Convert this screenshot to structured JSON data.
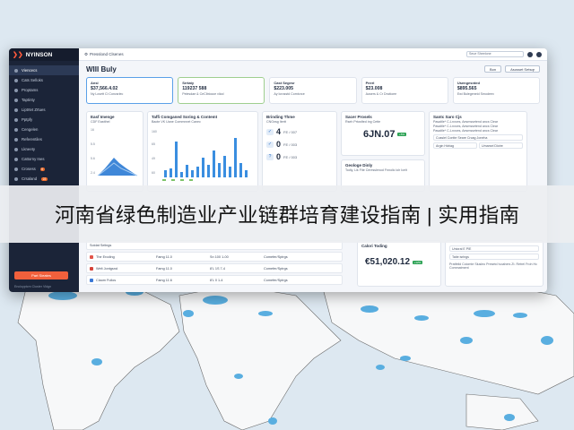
{
  "app": {
    "logo": "NYINSON",
    "workspace": "Presslond Clsenes",
    "search_placeholder": "Seue Sheelone"
  },
  "sidebar": {
    "items": [
      {
        "label": "Viencecs",
        "active": true
      },
      {
        "label": "Cats Selloks"
      },
      {
        "label": "Proptams"
      },
      {
        "label": "Taptinty"
      },
      {
        "label": "Liptrtet Zrtues"
      },
      {
        "label": "Pptpfy"
      },
      {
        "label": "Cengelen"
      },
      {
        "label": "Referentiles"
      },
      {
        "label": "Lkneety"
      },
      {
        "label": "Cattorny Ines"
      },
      {
        "label": "Crosess",
        "badge": "6"
      },
      {
        "label": "Crsaland",
        "badge": "22"
      }
    ],
    "cta": "Part Sieates",
    "footer": "Encloyptcm Cluster Vldgn"
  },
  "header": {
    "title": "WIII Buly",
    "btn1": "Bon",
    "btn2": "Asosset Setsqr"
  },
  "kpis": [
    {
      "title": "Ansl",
      "value": "$37,566.4.02",
      "sub": "Ny Lcsett Ci Concsrlec"
    },
    {
      "title": "Srrtaty",
      "value": "119237 588",
      "sub": "Pelesdae & CeClbtocce vliod"
    },
    {
      "title": "Cast Segesr",
      "value": "$223.005",
      "sub": "Ay Icrosstd Corntcrce"
    },
    {
      "title": "Peerl",
      "value": "$23.008",
      "sub": "Ausers & Cr Dnctioee"
    },
    {
      "title": "Usengesnted",
      "value": "$895.565",
      "sub": "Ewi Bulegeneid Smodeex"
    }
  ],
  "cards": {
    "area": {
      "title": "Easf Imenge",
      "sub": "CDF Eastthel",
      "ticks": [
        "16",
        "5.5",
        "5.6",
        "2.4"
      ]
    },
    "bars": {
      "title": "Taffi Comganed Soring & Contemt",
      "sub": "Baote VK Uane Commnnet Canec",
      "ticks": [
        "160",
        "65",
        "49",
        "60"
      ]
    },
    "binding": {
      "title": "Brinding Thme",
      "sub": "CNGnsg Itertt",
      "rows": [
        {
          "icon": "✓",
          "val": "4",
          "note": "FE / 007"
        },
        {
          "icon": "✓",
          "val": "0",
          "note": "FE / 003"
        },
        {
          "icon": "?",
          "val": "0",
          "note": "FE / 003"
        }
      ]
    },
    "sacer": {
      "title": "Sacer Prosels",
      "sub": "Rseh Prtosfted ing Cette",
      "big": "6JN.07",
      "pill": "+5%"
    },
    "santic": {
      "title": "Santc Saro Cjs",
      "lines": [
        "Pasaltle* C-Lnvces, Aesmssetend ancs Clear",
        "Pasaltle* C-Lnvces, Aesmssetend ancs Clear",
        "Pasaltle* C-Lnvces, Aesmssetend ancs Clear"
      ],
      "minis": [
        "Cusslel Contte Seare Crcag Joneha",
        "Argin Hdriag",
        "Umarsel Dictre"
      ]
    },
    "geologe": {
      "title": "Geologe Dinly",
      "sub": "Todly, Lik Fite Ceresslenod Fnnolic lolr Icelt"
    },
    "color": {
      "title": "Calori Toding",
      "big": "€51,020.12",
      "pill": "+12%"
    },
    "right2": {
      "minis": [
        "Unioral E PlE",
        "Tatie isrlngs"
      ],
      "text": "Pratfelid Cclomte Slusleo Presetd Ivoahers Zt. Retrel Froh Hc Commatment"
    }
  },
  "table": {
    "rows": [
      {
        "name": "Soldat Selings",
        "c2": "",
        "c3": "",
        "c4": ""
      },
      {
        "name": "The Eroding",
        "c2": "Famg 11.0",
        "c3": "Sn 100 1-00",
        "c4": "Comefer/Sptrgs",
        "color": "#e2554a"
      },
      {
        "name": "Welt Jontgsnd",
        "c2": "Famg 11.0",
        "c3": "8'L 1S 7-4",
        "c4": "Comefer/Sptrgs",
        "color": "#d6433a"
      },
      {
        "name": "Claom Fullos",
        "c2": "Famg 11.6",
        "c3": "8'L 0 1-4",
        "c4": "Comefer/Sptrgs",
        "color": "#3a78d6"
      }
    ]
  },
  "banner": {
    "text": "河南省绿色制造业产业链群培育建设指南 | 实用指南"
  }
}
